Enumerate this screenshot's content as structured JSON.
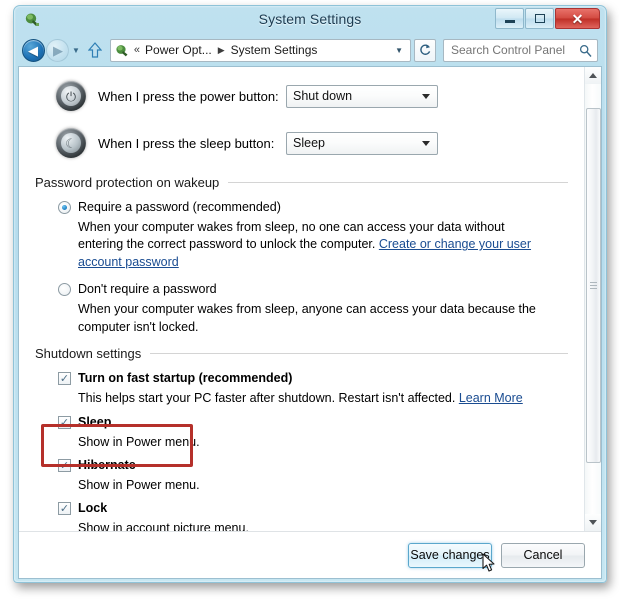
{
  "window": {
    "title": "System Settings",
    "app_icon": "power-plug-icon",
    "controls": {
      "minimize": "minimize-button",
      "maximize": "maximize-button",
      "close_label": "✕"
    }
  },
  "nav": {
    "back_label": "◀",
    "forward_label": "▶",
    "history_chevron": "▼",
    "up_label": "up-arrow",
    "refresh_label": "↯",
    "address_chevron": "▼",
    "breadcrumb": {
      "double_chevron": "«",
      "parent": "Power Opt...",
      "separator": "▶",
      "current": "System Settings"
    },
    "search": {
      "placeholder": "Search Control Panel",
      "value": "",
      "icon": "search-icon"
    }
  },
  "content": {
    "power_rows": [
      {
        "label": "When I press the power button:",
        "value": "Shut down",
        "icon": "power-button-icon"
      },
      {
        "label": "When I press the sleep button:",
        "value": "Sleep",
        "icon": "sleep-button-icon"
      }
    ],
    "password_group": {
      "title": "Password protection on wakeup",
      "options": [
        {
          "label": "Require a password (recommended)",
          "checked": true,
          "desc_before": "When your computer wakes from sleep, no one can access your data without entering the correct password to unlock the computer. ",
          "link": "Create or change your user account password"
        },
        {
          "label": "Don't require a password",
          "checked": false,
          "desc_before": "When your computer wakes from sleep, anyone can access your data because the computer isn't locked.",
          "link": ""
        }
      ]
    },
    "shutdown_group": {
      "title": "Shutdown settings",
      "checkmark": "✓",
      "items": [
        {
          "label": "Turn on fast startup (recommended)",
          "checked": true,
          "desc_before": "This helps start your PC faster after shutdown. Restart isn't affected. ",
          "link": "Learn More"
        },
        {
          "label": "Sleep",
          "checked": true,
          "desc_before": "Show in Power menu.",
          "link": ""
        },
        {
          "label": "Hibernate",
          "checked": true,
          "desc_before": "Show in Power menu.",
          "link": ""
        },
        {
          "label": "Lock",
          "checked": true,
          "desc_before": "Show in account picture menu.",
          "link": ""
        }
      ]
    },
    "highlight": {
      "target": "Hibernate",
      "color": "#b5302a"
    }
  },
  "footer": {
    "save_label": "Save changes",
    "cancel_label": "Cancel"
  },
  "colors": {
    "frame": "#b5dced",
    "accent": "#1f74b8",
    "close": "#d34b42",
    "link": "#1a4c91",
    "highlight": "#b5302a"
  }
}
